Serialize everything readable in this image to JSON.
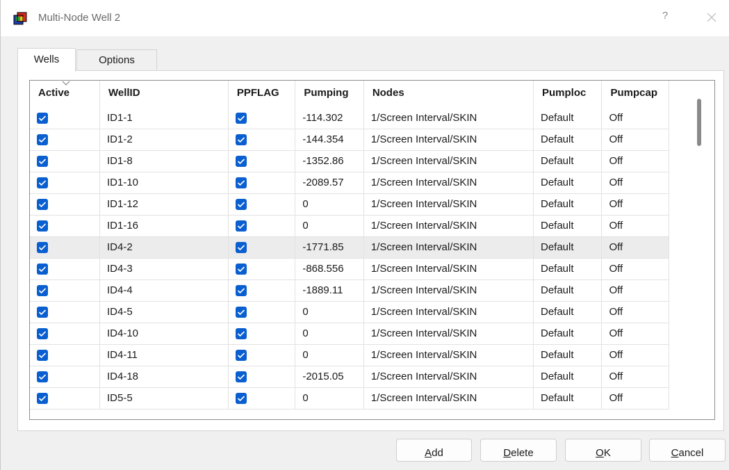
{
  "window": {
    "title": "Multi-Node Well 2",
    "help_label": "?"
  },
  "tabs": [
    {
      "label": "Wells",
      "active": true
    },
    {
      "label": "Options",
      "active": false
    }
  ],
  "grid": {
    "columns": [
      "Active",
      "WellID",
      "PPFLAG",
      "Pumping",
      "Nodes",
      "Pumploc",
      "Pumpcap"
    ],
    "selected_row": 6,
    "rows": [
      {
        "active": true,
        "wellid": "ID1-1",
        "ppflag": true,
        "pumping": "-114.302",
        "nodes": "1/Screen Interval/SKIN",
        "pumploc": "Default",
        "pumpcap": "Off"
      },
      {
        "active": true,
        "wellid": "ID1-2",
        "ppflag": true,
        "pumping": "-144.354",
        "nodes": "1/Screen Interval/SKIN",
        "pumploc": "Default",
        "pumpcap": "Off"
      },
      {
        "active": true,
        "wellid": "ID1-8",
        "ppflag": true,
        "pumping": "-1352.86",
        "nodes": "1/Screen Interval/SKIN",
        "pumploc": "Default",
        "pumpcap": "Off"
      },
      {
        "active": true,
        "wellid": "ID1-10",
        "ppflag": true,
        "pumping": "-2089.57",
        "nodes": "1/Screen Interval/SKIN",
        "pumploc": "Default",
        "pumpcap": "Off"
      },
      {
        "active": true,
        "wellid": "ID1-12",
        "ppflag": true,
        "pumping": "0",
        "nodes": "1/Screen Interval/SKIN",
        "pumploc": "Default",
        "pumpcap": "Off"
      },
      {
        "active": true,
        "wellid": "ID1-16",
        "ppflag": true,
        "pumping": "0",
        "nodes": "1/Screen Interval/SKIN",
        "pumploc": "Default",
        "pumpcap": "Off"
      },
      {
        "active": true,
        "wellid": "ID4-2",
        "ppflag": true,
        "pumping": "-1771.85",
        "nodes": "1/Screen Interval/SKIN",
        "pumploc": "Default",
        "pumpcap": "Off"
      },
      {
        "active": true,
        "wellid": "ID4-3",
        "ppflag": true,
        "pumping": "-868.556",
        "nodes": "1/Screen Interval/SKIN",
        "pumploc": "Default",
        "pumpcap": "Off"
      },
      {
        "active": true,
        "wellid": "ID4-4",
        "ppflag": true,
        "pumping": "-1889.11",
        "nodes": "1/Screen Interval/SKIN",
        "pumploc": "Default",
        "pumpcap": "Off"
      },
      {
        "active": true,
        "wellid": "ID4-5",
        "ppflag": true,
        "pumping": "0",
        "nodes": "1/Screen Interval/SKIN",
        "pumploc": "Default",
        "pumpcap": "Off"
      },
      {
        "active": true,
        "wellid": "ID4-10",
        "ppflag": true,
        "pumping": "0",
        "nodes": "1/Screen Interval/SKIN",
        "pumploc": "Default",
        "pumpcap": "Off"
      },
      {
        "active": true,
        "wellid": "ID4-11",
        "ppflag": true,
        "pumping": "0",
        "nodes": "1/Screen Interval/SKIN",
        "pumploc": "Default",
        "pumpcap": "Off"
      },
      {
        "active": true,
        "wellid": "ID4-18",
        "ppflag": true,
        "pumping": "-2015.05",
        "nodes": "1/Screen Interval/SKIN",
        "pumploc": "Default",
        "pumpcap": "Off"
      },
      {
        "active": true,
        "wellid": "ID5-5",
        "ppflag": true,
        "pumping": "0",
        "nodes": "1/Screen Interval/SKIN",
        "pumploc": "Default",
        "pumpcap": "Off"
      }
    ]
  },
  "buttons": {
    "add": {
      "mnemonic": "A",
      "rest": "dd"
    },
    "delete": {
      "mnemonic": "D",
      "rest": "elete"
    },
    "ok": {
      "mnemonic": "O",
      "rest": "K"
    },
    "cancel": {
      "mnemonic": "C",
      "rest": "ancel"
    }
  },
  "icons": {
    "app": "multi-node-well-app-icon",
    "help": "help-icon",
    "close": "close-icon",
    "checkbox": "checkbox-checked-icon",
    "sort": "sort-indicator-icon"
  },
  "colors": {
    "checkbox": "#0a5fd0",
    "selected_row": "#ececec"
  }
}
